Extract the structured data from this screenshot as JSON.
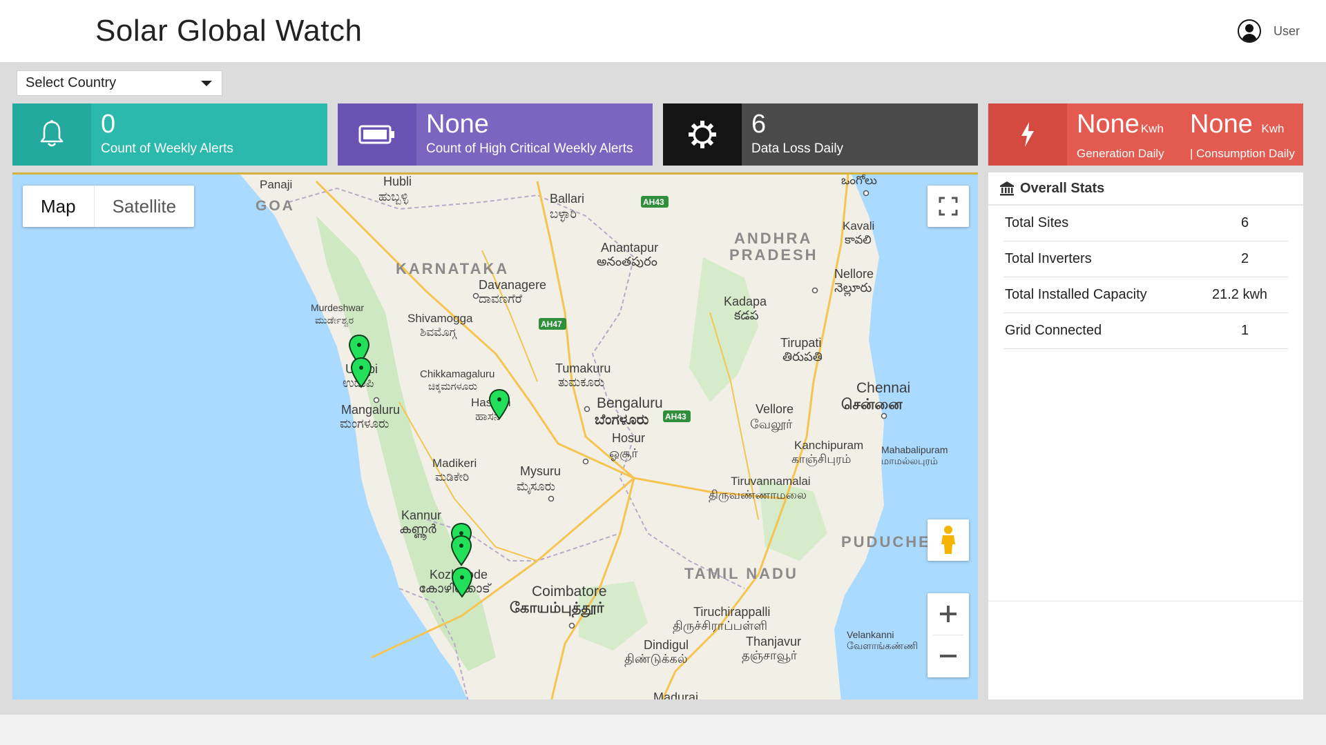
{
  "header": {
    "title": "Solar Global Watch",
    "user_label": "User",
    "user_icon": "user-circle-icon"
  },
  "filter": {
    "country_select": "Select Country"
  },
  "cards": [
    {
      "value": "0",
      "label": "Count of Weekly Alerts",
      "icon": "bell-icon",
      "color": "#2bb9ad"
    },
    {
      "value": "None",
      "label": "Count of High Critical Weekly Alerts",
      "icon": "battery-icon",
      "color": "#7c65c1"
    },
    {
      "value": "6",
      "label": "Data Loss Daily",
      "icon": "gear-icon",
      "color": "#4a4a4a"
    },
    {
      "icon": "bolt-icon",
      "color": "#e35a50",
      "generation": {
        "value": "None",
        "unit": "Kwh",
        "label": "Generation Daily"
      },
      "consumption": {
        "value": "None ",
        "unit": "Kwh",
        "label": "| Consumption Daily"
      }
    }
  ],
  "map": {
    "toggle": {
      "map": "Map",
      "satellite": "Satellite",
      "active": "Map"
    },
    "labels": {
      "panaji": "Panaji",
      "goa": "GOA",
      "hubli": "Hubli",
      "hubli_kn": "ಹುಬ್ಬಳ್ಳಿ",
      "ballari": "Ballari",
      "ballari_kn": "ಬಳ್ಳಾರಿ",
      "ah43_top": "AH43",
      "ongole": "ఒంగోలు",
      "kavali": "Kavali",
      "kavali_te": "కావలి",
      "andhra1": "ANDHRA",
      "andhra2": "PRADESH",
      "anantapur": "Anantapur",
      "anantapur_te": "అనంతపురం",
      "karnataka": "KARNATAKA",
      "davanagere": "Davanagere",
      "davanagere_kn": "ದಾವಣಗೆರೆ",
      "nellore": "Nellore",
      "nellore_te": "నెల్లూరు",
      "kadapa": "Kadapa",
      "kadapa_te": "కడప",
      "murdeshwar": "Murdeshwar",
      "murdeshwar_kn": "ಮುರ್ಡೇಶ್ವರ",
      "shivamogga": "Shivamogga",
      "shivamogga_kn": "ಶಿವಮೊಗ್ಗ",
      "ah47": "AH47",
      "tirupati": "Tirupati",
      "tirupati_te": "తిరుపతి",
      "udupi": "Udupi",
      "udupi_kn": "ಉಡುಪಿ",
      "chikkamagaluru": "Chikkamagaluru",
      "chikkamagaluru_kn": "ಚಿಕ್ಕಮಗಳೂರು",
      "tumakuru": "Tumakuru",
      "tumakuru_kn": "ತುಮಕೂರು",
      "chennai": "Chennai",
      "chennai_ta": "சென்னை",
      "hassan": "Hassan",
      "hassan_kn": "ಹಾಸನ",
      "bengaluru": "Bengaluru",
      "bengaluru_kn": "ಬೆಂಗಳೂರು",
      "vellore": "Vellore",
      "vellore_ta": "வேலூர்",
      "mangaluru": "Mangaluru",
      "mangaluru_kn": "ಮಂಗಳೂರು",
      "hosur": "Hosur",
      "hosur_ta": "ஓசூர்",
      "ah43_mid": "AH43",
      "kanchipuram": "Kanchipuram",
      "kanchipuram_ta": "காஞ்சிபுரம்",
      "mahabalipuram": "Mahabalipuram",
      "mahabalipuram_ta": "மாமல்லபுரம்",
      "madikeri": "Madikeri",
      "madikeri_kn": "ಮಡಿಕೇರಿ",
      "mysuru": "Mysuru",
      "mysuru_kn": "ಮೈಸೂರು",
      "tiruvannamalai": "Tiruvannamalai",
      "tiruvannamalai_ta": "திருவண்ணாமலை",
      "kannur": "Kannur",
      "kannur_ml": "കണ്ണൂർ",
      "puducherry": "PUDUCHERRY",
      "tamilnadu": "TAMIL NADU",
      "kozhikode": "Kozhikode",
      "kozhikode_ml": "കോഴിക്കോട്",
      "coimbatore": "Coimbatore",
      "coimbatore_ta": "கோயம்புத்தூர்",
      "tiruchirappalli": "Tiruchirappalli",
      "tiruchirappalli_ta": "திருச்சிராப்பள்ளி",
      "dindigul": "Dindigul",
      "dindigul_ta": "திண்டுக்கல்",
      "thanjavur": "Thanjavur",
      "thanjavur_ta": "தஞ்சாவூர்",
      "velankanni": "Velankanni",
      "velankanni_ta": "வேளாங்கண்ணி",
      "madurai": "Madurai"
    },
    "marker_color": "#22e05a"
  },
  "stats": {
    "title": "Overall Stats",
    "icon": "bank-icon",
    "rows": [
      {
        "label": "Total Sites",
        "value": "6"
      },
      {
        "label": "Total Inverters",
        "value": "2"
      },
      {
        "label": "Total Installed Capacity",
        "value": "21.2 kwh"
      },
      {
        "label": "Grid Connected",
        "value": "1"
      }
    ]
  }
}
